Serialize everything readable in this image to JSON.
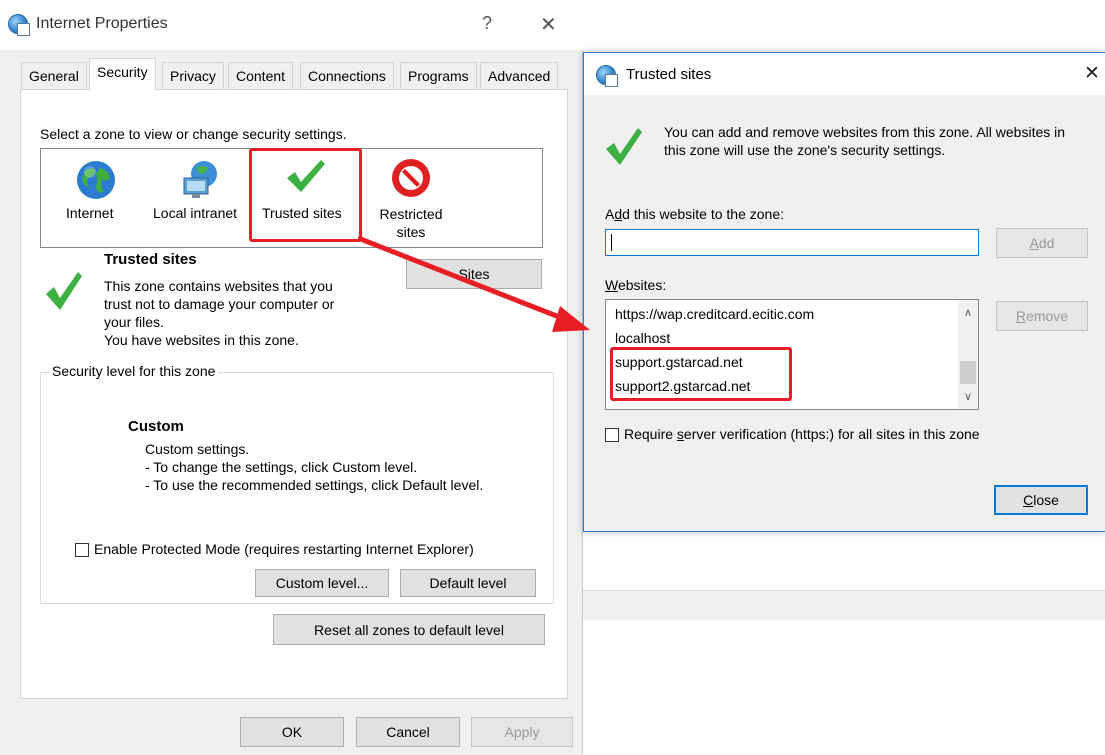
{
  "internet_properties": {
    "title": "Internet Properties",
    "help_glyph": "?",
    "close_glyph": "✕",
    "tabs": [
      {
        "label": "General"
      },
      {
        "label": "Security"
      },
      {
        "label": "Privacy"
      },
      {
        "label": "Content"
      },
      {
        "label": "Connections"
      },
      {
        "label": "Programs"
      },
      {
        "label": "Advanced"
      }
    ],
    "active_tab": "Security",
    "zone_prompt": "Select a zone to view or change security settings.",
    "zones": [
      {
        "label": "Internet",
        "icon": "globe-icon"
      },
      {
        "label": "Local intranet",
        "icon": "intranet-icon"
      },
      {
        "label": "Trusted sites",
        "icon": "checkmark-icon"
      },
      {
        "label": "Restricted sites",
        "icon": "restricted-icon"
      }
    ],
    "selected_zone": "Trusted sites",
    "zone_detail": {
      "heading": "Trusted sites",
      "lines": [
        "This zone contains websites that you",
        "trust not to damage your computer or",
        "your files.",
        "You have websites in this zone."
      ],
      "sites_button": "Sites"
    },
    "security_level": {
      "legend": "Security level for this zone",
      "level_name": "Custom",
      "lines": [
        "Custom settings.",
        "- To change the settings, click Custom level.",
        "- To use the recommended settings, click Default level."
      ]
    },
    "protected_mode_label": "Enable Protected Mode (requires restarting Internet Explorer)",
    "protected_mode_checked": false,
    "custom_level_button": "Custom level...",
    "default_level_button": "Default level",
    "reset_all_button": "Reset all zones to default level",
    "ok_button": "OK",
    "cancel_button": "Cancel",
    "apply_button": "Apply"
  },
  "trusted_sites_dialog": {
    "title": "Trusted sites",
    "close_glyph": "✕",
    "description_line1": "You can add and remove websites from this zone. All websites in",
    "description_line2": "this zone will use the zone's security settings.",
    "add_label_prefix": "A",
    "add_label_accel": "d",
    "add_label_rest": "d this website to the zone:",
    "add_input_value": "",
    "add_button_accel": "A",
    "add_button_rest": "dd",
    "websites_label_accel": "W",
    "websites_label_rest": "ebsites:",
    "websites": [
      "https://wap.creditcard.ecitic.com",
      "localhost",
      "support.gstarcad.net",
      "support2.gstarcad.net"
    ],
    "highlighted_websites": [
      "support.gstarcad.net",
      "support2.gstarcad.net"
    ],
    "remove_button_accel": "R",
    "remove_button_rest": "emove",
    "require_verification_prefix": "Require ",
    "require_verification_accel": "s",
    "require_verification_rest": "erver verification (https:) for all sites in this zone",
    "require_verification_checked": false,
    "close_button_accel": "C",
    "close_button_rest": "lose"
  },
  "colors": {
    "highlight_red": "#e81e25",
    "accent_blue": "#0078d7",
    "check_green": "#3cb043"
  }
}
